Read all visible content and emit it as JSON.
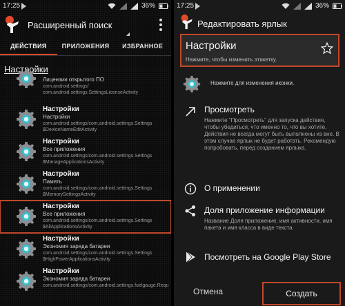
{
  "status_left": {
    "time": "17:25",
    "battery": "36%"
  },
  "status_right": {
    "time": "17:25",
    "battery": "36%"
  },
  "left_app": {
    "title": "Расширенный поиск",
    "tabs": [
      {
        "label": "ДЕЙСТВИЯ",
        "active": true
      },
      {
        "label": "ПРИЛОЖЕНИЯ",
        "active": false
      },
      {
        "label": "ИЗБРАННОЕ",
        "active": false
      }
    ],
    "section_title": "Настройки",
    "items": [
      {
        "title": "",
        "subtitle": "Лицензии открытого ПО",
        "path": "com.android.settings/",
        "activity": "com.android.settings.SettingsLicenseActivity"
      },
      {
        "title": "Настройки",
        "subtitle": "Настройки",
        "path": "com.android.settings/com.android.settings.Settings",
        "activity": "$DeviceNameEditActivity"
      },
      {
        "title": "Настройки",
        "subtitle": "Все приложения",
        "path": "com.android.settings/com.android.settings.Settings",
        "activity": "$ManageApplicationsActivity"
      },
      {
        "title": "Настройки",
        "subtitle": "Память",
        "path": "com.android.settings/com.android.settings.Settings",
        "activity": "$MemorySettingsActivity"
      },
      {
        "title": "Настройки",
        "subtitle": "Все приложения",
        "path": "com.android.settings/com.android.settings.Settings",
        "activity": "$AllApplicationsActivity",
        "selected": true
      },
      {
        "title": "Настройки",
        "subtitle": "Экономия заряда батареи",
        "path": "com.android.settings/com.android.settings.Settings",
        "activity": "$HighPowerApplicationsActivity"
      },
      {
        "title": "Настройки",
        "subtitle": "Экономия заряда батареи",
        "path": "com.android.settings/com.android.settings.fuelgauge.Requ",
        "activity": ""
      }
    ]
  },
  "right_app": {
    "title": "Редактировать ярлык",
    "label_name": "Настройки",
    "label_hint": "Нажмите, чтобы изменить этикетку.",
    "icon_hint": "Нажмите для изменения иконки.",
    "preview": {
      "label": "Просмотреть",
      "desc": "Нажмите \"Просмотреть\" для запуска действия, чтобы убедиться, что именно то, что вы хотите. Действия не всегда могут быть выполнены из вне. В этом случае ярлык не будет работать. Рекомендую попробовать, перед созданием ярлыка."
    },
    "about_label": "О применении",
    "share": {
      "label": "Доля приложение информации",
      "desc": "Название Доля приложение, имя активности, имя пакета и имя класса в виде текста."
    },
    "play_label": "Посмотреть на Google Play Store",
    "cancel_label": "Отмена",
    "create_label": "Создать"
  },
  "colors": {
    "accent": "#c0482c",
    "tab_indicator": "#d8482a"
  }
}
